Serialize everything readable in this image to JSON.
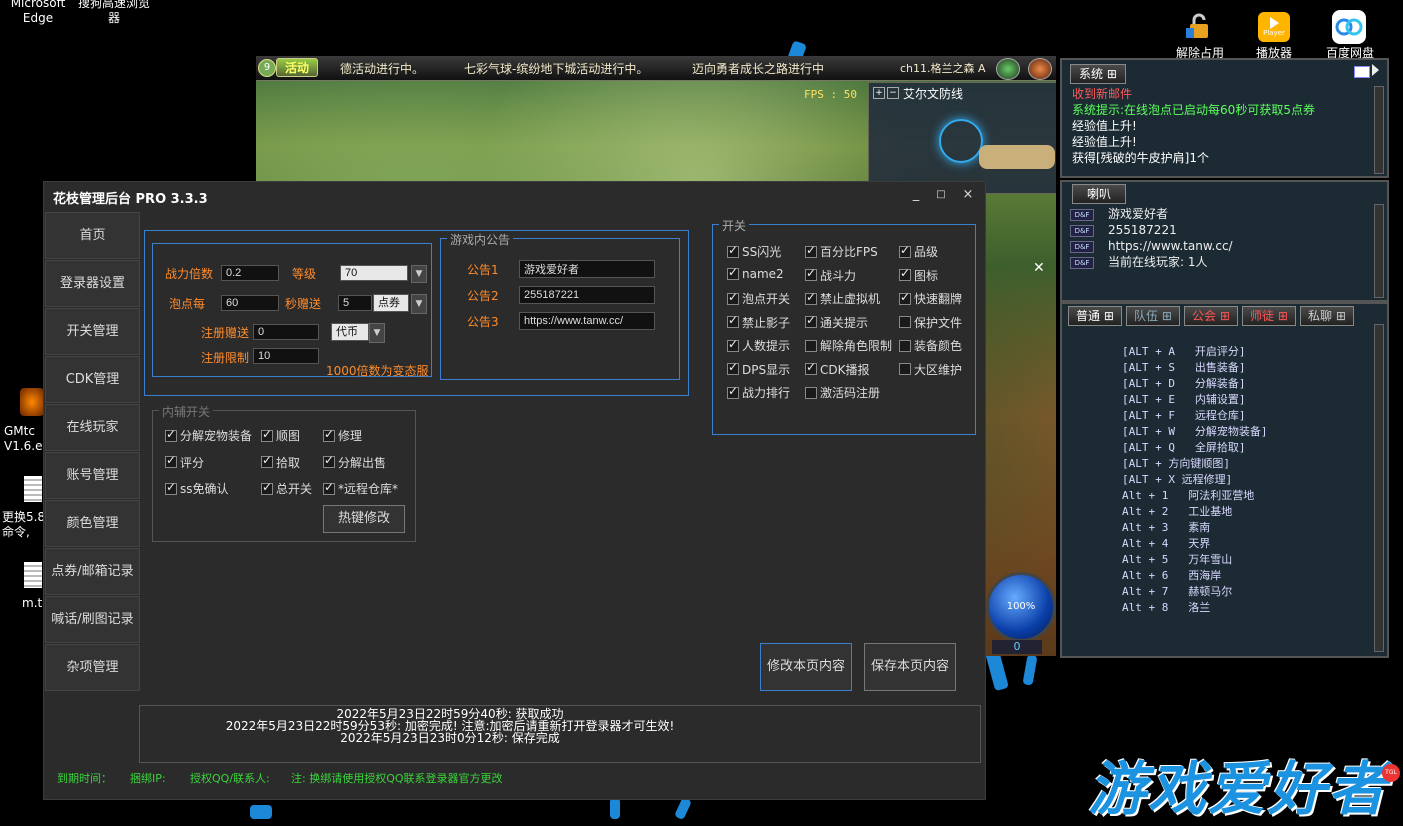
{
  "desktop": {
    "icons_top_left": [
      "Microsoft\nEdge",
      "搜狗高速浏览\n器"
    ],
    "icons_top_right": [
      "解除占用",
      "播放器",
      "百度网盘"
    ],
    "player_badge": "Player",
    "icons_left": [
      "GMtc\nV1.6.e",
      "更换5.8\n命令,",
      "m.t"
    ]
  },
  "game": {
    "activity_button": "活动",
    "channel_level": "9",
    "ticker": [
      "德活动进行中。",
      "七彩气球-缤纷地下城活动进行中。",
      "迈向勇者成长之路进行中"
    ],
    "channel": "ch11.格兰之森 A",
    "fps": "FPS : 50",
    "minimap_title": "艾尔文防线",
    "minimap_town": "艾尔文防线",
    "orb_percent": "100%",
    "orb_count": "0"
  },
  "system_panel": {
    "tab": "系统",
    "messages": [
      {
        "text": "收到新邮件",
        "color": "#ff5a5a"
      },
      {
        "text": "系统提示:在线泡点已启动每60秒可获取5点券",
        "color": "#5dff5d"
      },
      {
        "text": "经验值上升!",
        "color": "#ffffff"
      },
      {
        "text": "经验值上升!",
        "color": "#ffffff"
      },
      {
        "text": "获得[残破的牛皮护肩]1个",
        "color": "#ffffff"
      }
    ]
  },
  "horn_panel": {
    "tab": "喇叭",
    "badge": "D&F",
    "messages": [
      "游戏爱好者",
      "255187221",
      "https://www.tanw.cc/",
      "当前在线玩家: 1人"
    ]
  },
  "chat_panel": {
    "tabs": [
      "普通",
      "队伍",
      "公会",
      "师徒",
      "私聊"
    ],
    "commands": [
      "[ALT + A   开启评分]",
      "[ALT + S   出售装备]",
      "[ALT + D   分解装备]",
      "[ALT + E   内辅设置]",
      "[ALT + F   远程仓库]",
      "[ALT + W   分解宠物装备]",
      "[ALT + Q   全屏拾取]",
      "[ALT + 方向键顺图]",
      "[ALT + X 远程修理]",
      "Alt + 1   阿法利亚营地",
      "Alt + 2   工业基地",
      "Alt + 3   素南",
      "Alt + 4   天界",
      "Alt + 5   万年雪山",
      "Alt + 6   西海岸",
      "Alt + 7   赫顿马尔",
      "Alt + 8   洛兰"
    ]
  },
  "window": {
    "title": "花枝管理后台 PRO 3.3.3",
    "controls": [
      "_",
      "□",
      "×"
    ],
    "nav": [
      "首页",
      "登录器设置",
      "开关管理",
      "CDK管理",
      "在线玩家",
      "账号管理",
      "颜色管理",
      "点券/邮箱记录",
      "喊话/刷图记录",
      "杂项管理"
    ],
    "settings": {
      "power_label": "战力倍数",
      "power_value": "0.2",
      "level_label": "等级",
      "level_value": "70",
      "bubble_label": "泡点每",
      "bubble_value": "60",
      "seconds_label": "秒赠送",
      "seconds_value": "5",
      "currency_option": "点券",
      "reg_gift_label": "注册赠送",
      "reg_gift_value": "0",
      "reg_gift_option": "代币",
      "reg_limit_label": "注册限制",
      "reg_limit_value": "10",
      "note": "1000倍数为变态服"
    },
    "announcements": {
      "legend": "游戏内公告",
      "labels": [
        "公告1",
        "公告2",
        "公告3"
      ],
      "values": [
        "游戏爱好者",
        "255187221",
        "https://www.tanw.cc/"
      ]
    },
    "switches": {
      "legend": "开关",
      "items": [
        {
          "label": "SS闪光",
          "checked": true
        },
        {
          "label": "百分比FPS",
          "checked": true
        },
        {
          "label": "品级",
          "checked": true
        },
        {
          "label": "name2",
          "checked": true
        },
        {
          "label": "战斗力",
          "checked": true
        },
        {
          "label": "图标",
          "checked": true
        },
        {
          "label": "泡点开关",
          "checked": true
        },
        {
          "label": "禁止虚拟机",
          "checked": true
        },
        {
          "label": "快速翻牌",
          "checked": true
        },
        {
          "label": "禁止影子",
          "checked": true
        },
        {
          "label": "通关提示",
          "checked": true
        },
        {
          "label": "保护文件",
          "checked": false
        },
        {
          "label": "人数提示",
          "checked": true
        },
        {
          "label": "解除角色限制",
          "checked": false
        },
        {
          "label": "装备颜色",
          "checked": false
        },
        {
          "label": "DPS显示",
          "checked": true
        },
        {
          "label": "CDK播报",
          "checked": true
        },
        {
          "label": "大区维护",
          "checked": false
        },
        {
          "label": "战力排行",
          "checked": true
        },
        {
          "label": "激活码注册",
          "checked": false
        }
      ]
    },
    "assist": {
      "legend": "内辅开关",
      "items": [
        {
          "label": "分解宠物装备",
          "checked": true
        },
        {
          "label": "顺图",
          "checked": true
        },
        {
          "label": "修理",
          "checked": true
        },
        {
          "label": "评分",
          "checked": true
        },
        {
          "label": "拾取",
          "checked": true
        },
        {
          "label": "分解出售",
          "checked": true
        },
        {
          "label": "ss免确认",
          "checked": true
        },
        {
          "label": "总开关",
          "checked": true
        },
        {
          "label": "*远程仓库*",
          "checked": true
        }
      ],
      "hotkey_button": "热键修改"
    },
    "buttons": {
      "modify": "修改本页内容",
      "save": "保存本页内容"
    },
    "log": [
      "2022年5月23日22时59分40秒: 获取成功",
      "2022年5月23日22时59分53秒: 加密完成! 注意:加密后请重新打开登录器才可生效!",
      "2022年5月23日23时0分12秒: 保存完成"
    ],
    "footer": {
      "expire": "到期时间：",
      "bind_ip": "捆绑IP:",
      "auth_qq": "授权QQ/联系人:",
      "note": "注: 换绑请使用授权QQ联系登录器官方更改"
    }
  },
  "watermark": "游戏爱好者",
  "watermark_badge": "TGL"
}
